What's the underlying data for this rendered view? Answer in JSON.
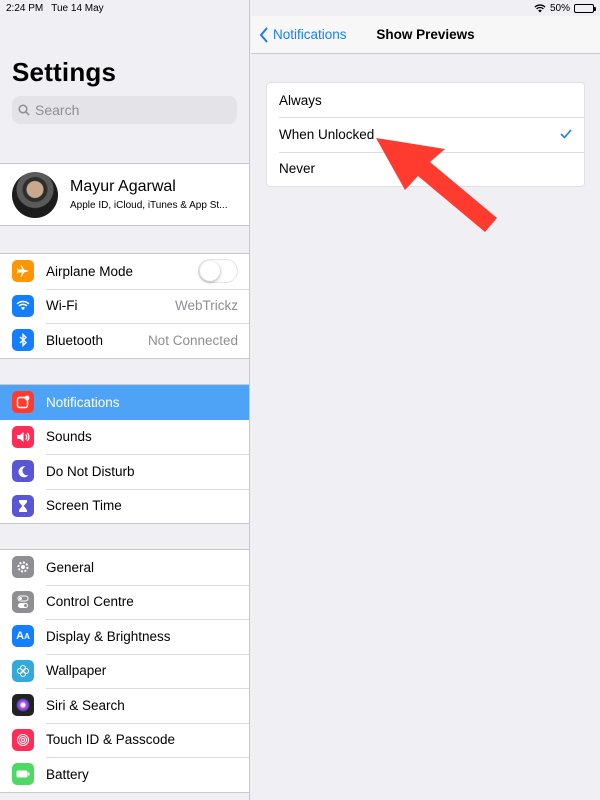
{
  "status": {
    "time": "2:24 PM",
    "date": "Tue 14 May",
    "battery": "50%",
    "battery_level": 0.5
  },
  "sidebar": {
    "title": "Settings",
    "search_placeholder": "Search",
    "profile": {
      "name": "Mayur Agarwal",
      "subtitle": "Apple ID, iCloud, iTunes & App St..."
    },
    "group1": [
      {
        "label": "Airplane Mode",
        "icon": "airplane-icon",
        "color": "#ff9500"
      },
      {
        "label": "Wi-Fi",
        "value": "WebTrickz",
        "icon": "wifi-icon",
        "color": "#147efb"
      },
      {
        "label": "Bluetooth",
        "value": "Not Connected",
        "icon": "bluetooth-icon",
        "color": "#147efb"
      }
    ],
    "group2": [
      {
        "label": "Notifications",
        "icon": "notifications-icon",
        "color": "#ff3b30",
        "selected": true
      },
      {
        "label": "Sounds",
        "icon": "speaker-icon",
        "color": "#ff2d55"
      },
      {
        "label": "Do Not Disturb",
        "icon": "moon-icon",
        "color": "#5856d6"
      },
      {
        "label": "Screen Time",
        "icon": "hourglass-icon",
        "color": "#5856d6"
      }
    ],
    "group3": [
      {
        "label": "General",
        "icon": "gear-icon",
        "color": "#8e8e93"
      },
      {
        "label": "Control Centre",
        "icon": "toggles-icon",
        "color": "#8e8e93"
      },
      {
        "label": "Display & Brightness",
        "icon": "aa-icon",
        "color": "#147efb"
      },
      {
        "label": "Wallpaper",
        "icon": "flower-icon",
        "color": "#34aadc"
      },
      {
        "label": "Siri & Search",
        "icon": "siri-icon",
        "color": "#222"
      },
      {
        "label": "Touch ID & Passcode",
        "icon": "fingerprint-icon",
        "color": "#ff2d55"
      },
      {
        "label": "Battery",
        "icon": "battery-icon",
        "color": "#4cd964"
      }
    ]
  },
  "detail": {
    "back_label": "Notifications",
    "title": "Show Previews",
    "options": [
      {
        "label": "Always",
        "checked": false
      },
      {
        "label": "When Unlocked",
        "checked": true
      },
      {
        "label": "Never",
        "checked": false
      }
    ]
  },
  "colors": {
    "accent": "#147efb",
    "selected_row": "#4fa3f7",
    "annotation_arrow": "#ff3b30"
  }
}
